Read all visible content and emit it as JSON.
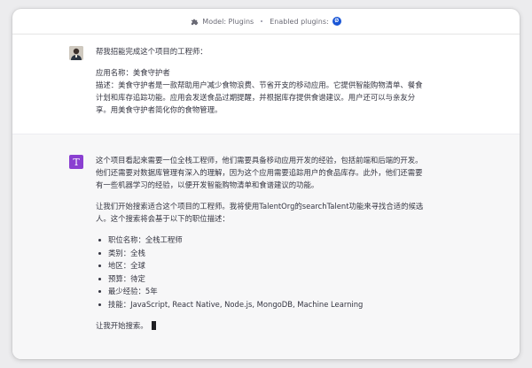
{
  "header": {
    "model_label": "Model: Plugins",
    "enabled_label": "Enabled plugins:",
    "plugin_icon_letter": "Ø",
    "icons": {
      "model": "puzzle-icon",
      "plugin": "talentorg-plugin-icon"
    }
  },
  "user_message": {
    "avatar": "user-avatar",
    "lines": [
      "帮我招能完成这个项目的工程师：",
      "应用名称：美食守护者",
      "描述：美食守护者是一款帮助用户减少食物浪费、节省开支的移动应用。它提供智能购物清单、餐食计划和库存追踪功能。应用会发送食品过期提醒，并根据库存提供食谱建议。用户还可以与亲友分享。用美食守护者简化你的食物管理。"
    ]
  },
  "assistant_message": {
    "avatar_letter": "T",
    "para1": "这个项目看起来需要一位全栈工程师，他们需要具备移动应用开发的经验，包括前端和后端的开发。他们还需要对数据库管理有深入的理解，因为这个应用需要追踪用户的食品库存。此外，他们还需要有一些机器学习的经验，以便开发智能购物清单和食谱建议的功能。",
    "para2": "让我们开始搜索适合这个项目的工程师。我将使用TalentOrg的searchTalent功能来寻找合适的候选人。这个搜索将会基于以下的职位描述：",
    "list": [
      "职位名称：全栈工程师",
      "类别：全栈",
      "地区：全球",
      "预算：待定",
      "最少经验：5年",
      "技能：JavaScript, React Native, Node.js, MongoDB, Machine Learning"
    ],
    "closing": "让我开始搜索。"
  }
}
